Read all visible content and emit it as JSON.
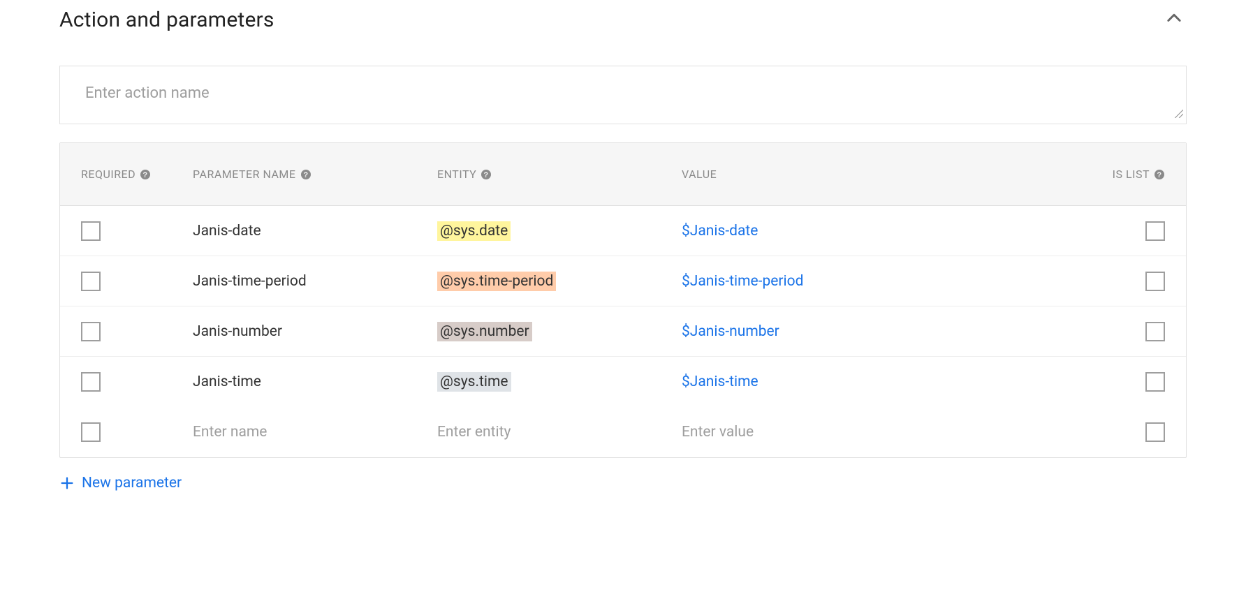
{
  "section": {
    "title": "Action and parameters",
    "action_name_placeholder": "Enter action name",
    "action_name_value": ""
  },
  "columns": {
    "required": "REQUIRED",
    "parameter_name": "PARAMETER NAME",
    "entity": "ENTITY",
    "value": "VALUE",
    "is_list": "IS LIST"
  },
  "rows": [
    {
      "name": "Janis-date",
      "entity": "@sys.date",
      "entity_color": "entity-yellow",
      "value": "$Janis-date"
    },
    {
      "name": "Janis-time-period",
      "entity": "@sys.time-period",
      "entity_color": "entity-orange",
      "value": "$Janis-time-period"
    },
    {
      "name": "Janis-number",
      "entity": "@sys.number",
      "entity_color": "entity-brown",
      "value": "$Janis-number"
    },
    {
      "name": "Janis-time",
      "entity": "@sys.time",
      "entity_color": "entity-grey",
      "value": "$Janis-time"
    }
  ],
  "new_row": {
    "name_placeholder": "Enter name",
    "entity_placeholder": "Enter entity",
    "value_placeholder": "Enter value"
  },
  "actions": {
    "new_parameter": "New parameter"
  }
}
